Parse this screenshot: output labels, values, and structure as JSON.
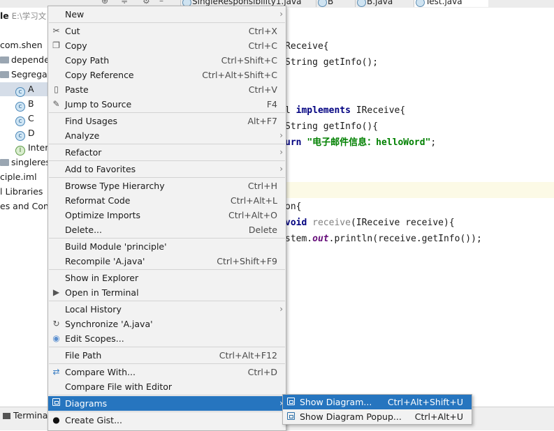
{
  "tabs": [
    {
      "label": "SingleResponsibility1.java"
    },
    {
      "label": "B"
    },
    {
      "label": "B.java"
    },
    {
      "label": "Test.java"
    }
  ],
  "project": {
    "header_label": "le",
    "header_path": "E:\\学习文",
    "items": [
      {
        "label": "com.shen"
      },
      {
        "label": "depende"
      },
      {
        "label": "Segregat"
      },
      {
        "label": "A"
      },
      {
        "label": "B"
      },
      {
        "label": "C"
      },
      {
        "label": "D"
      },
      {
        "label": "InterF"
      },
      {
        "label": "singleres"
      },
      {
        "label": "ciple.iml"
      },
      {
        "label": "l Libraries"
      },
      {
        "label": "es and Cons"
      }
    ],
    "terminal_label": "Termina"
  },
  "editor": {
    "lines": [
      {
        "text": "Receive{"
      },
      {
        "text": "String getInfo();"
      },
      {
        "kw": "implements",
        "pre": "l ",
        "post": " IReceive{"
      },
      {
        "text": "String getInfo(){"
      },
      {
        "pre": "urn ",
        "str": "\"电子邮件信息：helloWord\"",
        "post": ";"
      },
      {
        "text": "on{"
      },
      {
        "kw": "void",
        "unused": "receive",
        "post": "(IReceive receive){"
      },
      {
        "pre": "stem.",
        "fld": "out",
        "post": ".println(receive.getInfo());"
      }
    ]
  },
  "menu": {
    "items": [
      {
        "label": "New",
        "shortcut": "",
        "submenu": true
      },
      {
        "label": "Cut",
        "shortcut": "Ctrl+X",
        "icon": "cut-icon"
      },
      {
        "label": "Copy",
        "shortcut": "Ctrl+C",
        "icon": "copy-icon"
      },
      {
        "label": "Copy Path",
        "shortcut": "Ctrl+Shift+C"
      },
      {
        "label": "Copy Reference",
        "shortcut": "Ctrl+Alt+Shift+C"
      },
      {
        "label": "Paste",
        "shortcut": "Ctrl+V",
        "icon": "paste-icon"
      },
      {
        "label": "Jump to Source",
        "shortcut": "F4",
        "icon": "pencil-icon"
      },
      {
        "label": "Find Usages",
        "shortcut": "Alt+F7"
      },
      {
        "label": "Analyze",
        "shortcut": "",
        "submenu": true
      },
      {
        "label": "Refactor",
        "shortcut": "",
        "submenu": true
      },
      {
        "label": "Add to Favorites",
        "shortcut": "",
        "submenu": true
      },
      {
        "label": "Browse Type Hierarchy",
        "shortcut": "Ctrl+H"
      },
      {
        "label": "Reformat Code",
        "shortcut": "Ctrl+Alt+L"
      },
      {
        "label": "Optimize Imports",
        "shortcut": "Ctrl+Alt+O"
      },
      {
        "label": "Delete...",
        "shortcut": "Delete"
      },
      {
        "label": "Build Module 'principle'",
        "shortcut": ""
      },
      {
        "label": "Recompile 'A.java'",
        "shortcut": "Ctrl+Shift+F9"
      },
      {
        "label": "Show in Explorer",
        "shortcut": ""
      },
      {
        "label": "Open in Terminal",
        "shortcut": "",
        "icon": "terminal-icon"
      },
      {
        "label": "Local History",
        "shortcut": "",
        "submenu": true
      },
      {
        "label": "Synchronize 'A.java'",
        "shortcut": "",
        "icon": "sync-icon"
      },
      {
        "label": "Edit Scopes...",
        "shortcut": "",
        "icon": "scope-icon"
      },
      {
        "label": "File Path",
        "shortcut": "Ctrl+Alt+F12"
      },
      {
        "label": "Compare With...",
        "shortcut": "Ctrl+D",
        "icon": "compare-icon"
      },
      {
        "label": "Compare File with Editor",
        "shortcut": ""
      },
      {
        "label": "Diagrams",
        "shortcut": "",
        "submenu": true,
        "icon": "diagram-icon",
        "highlighted": true
      },
      {
        "label": "Create Gist...",
        "shortcut": "",
        "icon": "github-icon"
      }
    ]
  },
  "submenu": {
    "items": [
      {
        "label": "Show Diagram...",
        "shortcut": "Ctrl+Alt+Shift+U",
        "highlighted": true
      },
      {
        "label": "Show Diagram Popup...",
        "shortcut": "Ctrl+Alt+U"
      }
    ]
  },
  "colors": {
    "highlight": "#2675bf",
    "menu_bg": "#f2f2f2",
    "keyword": "#000080",
    "string": "#008000"
  }
}
